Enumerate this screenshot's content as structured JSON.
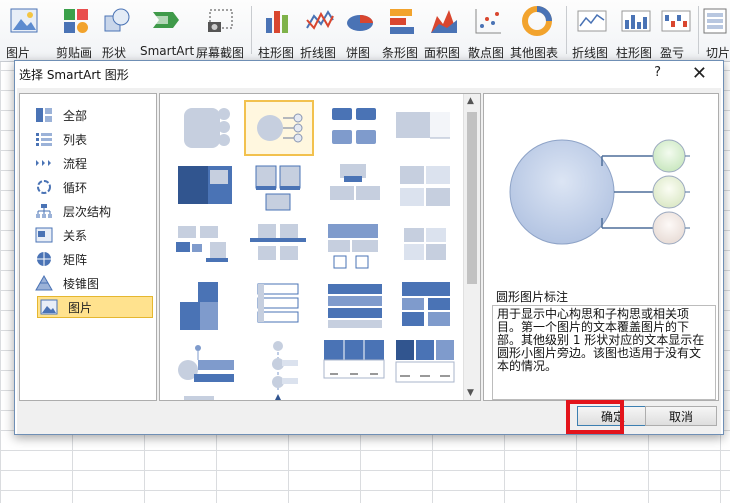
{
  "ribbon": {
    "items": [
      {
        "label": "图片",
        "icon": "picture-icon"
      },
      {
        "label": "剪贴画",
        "icon": "clip-art-icon"
      },
      {
        "label": "形状",
        "icon": "shapes-icon"
      },
      {
        "label": "SmartArt",
        "icon": "smartart-icon"
      },
      {
        "label": "屏幕截图",
        "icon": "screenshot-icon"
      },
      {
        "label": "柱形图",
        "icon": "column-chart-icon"
      },
      {
        "label": "折线图",
        "icon": "line-chart-icon"
      },
      {
        "label": "饼图",
        "icon": "pie-chart-icon"
      },
      {
        "label": "条形图",
        "icon": "bar-chart-icon"
      },
      {
        "label": "面积图",
        "icon": "area-chart-icon"
      },
      {
        "label": "散点图",
        "icon": "scatter-chart-icon"
      },
      {
        "label": "其他图表",
        "icon": "other-charts-icon"
      },
      {
        "label": "折线图",
        "icon": "sparkline-line-icon"
      },
      {
        "label": "柱形图",
        "icon": "sparkline-column-icon"
      },
      {
        "label": "盈亏",
        "icon": "sparkline-winloss-icon"
      },
      {
        "label": "切片",
        "icon": "slicer-icon"
      }
    ]
  },
  "dialog": {
    "title": "选择 SmartArt 图形",
    "help": "?",
    "close": "✕",
    "categories": [
      {
        "label": "全部",
        "icon": "all-icon"
      },
      {
        "label": "列表",
        "icon": "list-icon"
      },
      {
        "label": "流程",
        "icon": "process-icon"
      },
      {
        "label": "循环",
        "icon": "cycle-icon"
      },
      {
        "label": "层次结构",
        "icon": "hierarchy-icon"
      },
      {
        "label": "关系",
        "icon": "relationship-icon"
      },
      {
        "label": "矩阵",
        "icon": "matrix-icon"
      },
      {
        "label": "棱锥图",
        "icon": "pyramid-icon"
      },
      {
        "label": "图片",
        "icon": "picture-category-icon"
      }
    ],
    "selected_category": "图片",
    "preview": {
      "title": "圆形图片标注",
      "description": "用于显示中心构思和子构思或相关项目。第一个图片的文本覆盖图片的下部。其他级别 1 形状对应的文本显示在圆形小图片旁边。该图也适用于没有文本的情况。"
    },
    "ok_label": "确定",
    "cancel_label": "取消"
  },
  "colors": {
    "accent_blue": "#4a73b5",
    "light_blue": "#b8c7e0",
    "selection_yellow": "#ffe28e",
    "highlight_red": "#e3141b"
  }
}
